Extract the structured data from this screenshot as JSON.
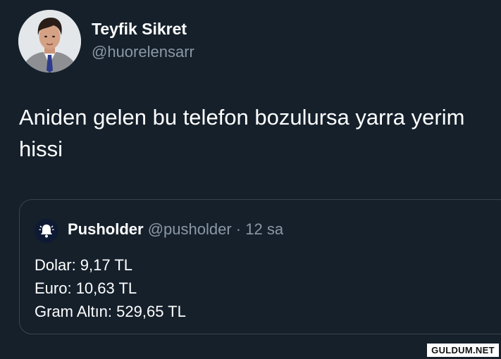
{
  "tweet": {
    "author": {
      "display_name": "Teyfik Sikret",
      "handle": "@huorelensarr",
      "avatar_icon": "profile-photo"
    },
    "text": "Aniden gelen bu telefon bozulursa yarra yerim hissi"
  },
  "quoted_tweet": {
    "author": {
      "display_name": "Pusholder",
      "handle": "@pusholder",
      "avatar_icon": "bell-icon"
    },
    "separator": "·",
    "time": "12 sa",
    "lines": [
      "Dolar: 9,17 TL",
      "Euro: 10,63 TL",
      "Gram Altın: 529,65 TL"
    ]
  },
  "watermark": "GULDUM.NET",
  "colors": {
    "background": "#15202b",
    "text_primary": "#ffffff",
    "text_secondary": "#8b98a5",
    "card_border": "#38444d"
  }
}
